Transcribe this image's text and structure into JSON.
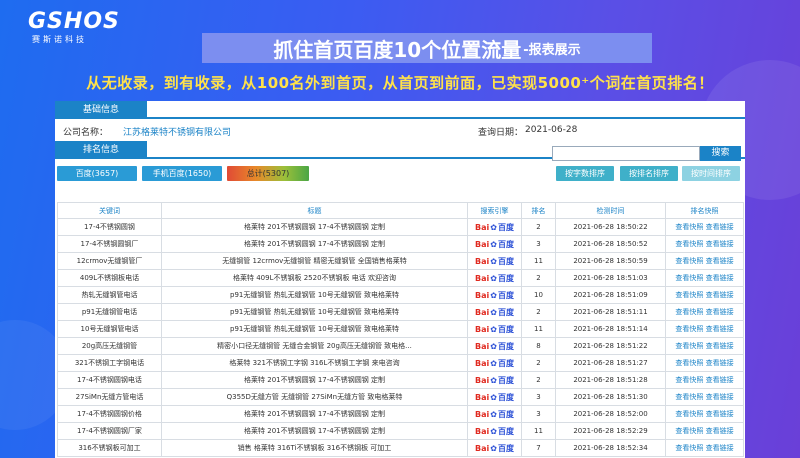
{
  "logo": {
    "main": "GSHOS",
    "sub": "赛斯诺科技"
  },
  "banner": {
    "title": "抓住首页百度10个位置流量",
    "subtitle": "-报表展示"
  },
  "slogan": "从无收录，到有收录，从100名外到首页，从首页到前面，已实现5000⁺个词在首页排名！",
  "basic_info": {
    "tab": "基础信息",
    "company_label": "公司名称：",
    "company_value": "江苏格莱特不锈钢有限公司",
    "date_label": "查询日期：",
    "date_value": "2021-06-28"
  },
  "ranking": {
    "tab": "排名信息",
    "search_button": "搜索",
    "btn_baidu": "百度(3657)",
    "btn_mobile": "手机百度(1650)",
    "btn_total": "总计(5307)",
    "btn_sort_keyword": "按字数排序",
    "btn_sort_rank": "按排名排序",
    "btn_sort_time": "按时间排序"
  },
  "table": {
    "headers": [
      "关键词",
      "标题",
      "搜索引擎",
      "排名",
      "检测时间",
      "排名快照"
    ],
    "engine": {
      "b1": "Bai",
      "paw": "✿",
      "b2": "百度"
    },
    "links": [
      "查看快照",
      "查看链接"
    ],
    "rows": [
      {
        "keyword": "17-4不锈钢圆钢",
        "title": "格莱特 201不锈钢圆钢 17-4不锈钢圆钢 定制",
        "rank": "2",
        "time": "2021-06-28 18:50:22"
      },
      {
        "keyword": "17-4不锈钢圆钢厂",
        "title": "格莱特 201不锈钢圆钢 17-4不锈钢圆钢 定制",
        "rank": "3",
        "time": "2021-06-28 18:50:52"
      },
      {
        "keyword": "12crmov无缝钢管厂",
        "title": "无缝钢管 12crmov无缝钢管 精密无缝钢管 全国销售格莱特",
        "rank": "11",
        "time": "2021-06-28 18:50:59"
      },
      {
        "keyword": "409L不锈钢板电话",
        "title": "格莱特 409L不锈钢板 2520不锈钢板 电话 欢迎咨询",
        "rank": "2",
        "time": "2021-06-28 18:51:03"
      },
      {
        "keyword": "热轧无缝钢管电话",
        "title": "p91无缝钢管 热轧无缝钢管 10号无缝钢管 致电格莱特",
        "rank": "10",
        "time": "2021-06-28 18:51:09"
      },
      {
        "keyword": "p91无缝钢管电话",
        "title": "p91无缝钢管 热轧无缝钢管 10号无缝钢管 致电格莱特",
        "rank": "2",
        "time": "2021-06-28 18:51:11"
      },
      {
        "keyword": "10号无缝钢管电话",
        "title": "p91无缝钢管 热轧无缝钢管 10号无缝钢管 致电格莱特",
        "rank": "11",
        "time": "2021-06-28 18:51:14"
      },
      {
        "keyword": "20g高压无缝钢管",
        "title": "精密小口径无缝钢管 无缝合金钢管 20g高压无缝钢管 致电格...",
        "rank": "8",
        "time": "2021-06-28 18:51:22"
      },
      {
        "keyword": "321不锈钢工字钢电话",
        "title": "格莱特 321不锈钢工字钢 316L不锈钢工字钢 来电咨询",
        "rank": "2",
        "time": "2021-06-28 18:51:27"
      },
      {
        "keyword": "17-4不锈钢圆钢电话",
        "title": "格莱特 201不锈钢圆钢 17-4不锈钢圆钢 定制",
        "rank": "2",
        "time": "2021-06-28 18:51:28"
      },
      {
        "keyword": "27SiMn无缝方管电话",
        "title": "Q355D无缝方管 无缝钢管 27SiMn无缝方管 致电格莱特",
        "rank": "3",
        "time": "2021-06-28 18:51:30"
      },
      {
        "keyword": "17-4不锈钢圆钢价格",
        "title": "格莱特 201不锈钢圆钢 17-4不锈钢圆钢 定制",
        "rank": "3",
        "time": "2021-06-28 18:52:00"
      },
      {
        "keyword": "17-4不锈钢圆钢厂家",
        "title": "格莱特 201不锈钢圆钢 17-4不锈钢圆钢 定制",
        "rank": "11",
        "time": "2021-06-28 18:52:29"
      },
      {
        "keyword": "316不锈钢板可加工",
        "title": "销售 格莱特 316Ti不锈钢板 316不锈钢板 可加工",
        "rank": "7",
        "time": "2021-06-28 18:52:34"
      }
    ]
  }
}
